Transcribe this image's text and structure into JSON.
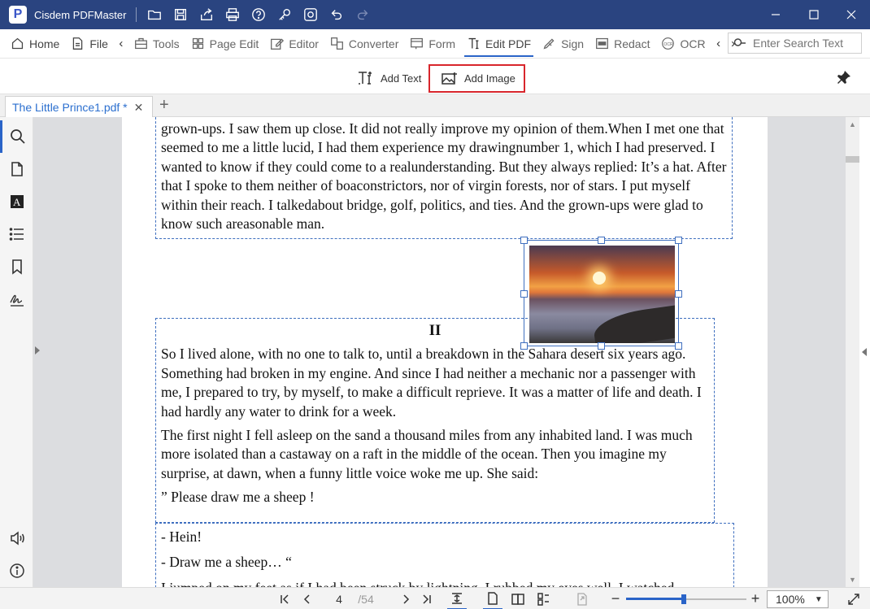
{
  "app": {
    "logo_letter": "P",
    "name": "Cisdem PDFMaster"
  },
  "menu": {
    "home": "Home",
    "file": "File",
    "tools": "Tools",
    "page_edit": "Page Edit",
    "editor": "Editor",
    "converter": "Converter",
    "form": "Form",
    "edit_pdf": "Edit PDF",
    "sign": "Sign",
    "redact": "Redact",
    "ocr": "OCR",
    "search_placeholder": "Enter Search Text"
  },
  "subtoolbar": {
    "add_text": "Add Text",
    "add_image": "Add Image"
  },
  "tab": {
    "title": "The Little Prince1.pdf *",
    "close": "✕",
    "add": "+"
  },
  "document": {
    "block1": "grown-ups. I saw them up close. It did not really improve my opinion of them.When I met one that seemed to me a little lucid, I had them experience my drawingnumber 1, which I had preserved. I wanted to know if they could come to a realunderstanding. But they always replied: It’s a hat. After that I spoke to them neither of boaconstrictors, nor of virgin forests, nor of stars. I put myself within their reach. I talkedabout bridge, golf, politics, and ties. And the grown-ups were glad to know such areasonable man.",
    "heading": "II",
    "para1": "So I lived alone, with no one to talk to, until a breakdown in the Sahara desert six years ago. Something had broken in my engine. And since I had neither a mechanic nor a passenger with me, I prepared to try, by myself, to make a difficult reprieve. It was a matter of life and death. I had hardly any water to drink for a week.",
    "para2": "The first night I fell asleep on the sand a thousand miles from any inhabited land. I was much more isolated than a castaway on a raft in the middle of the ocean. Then you imagine my surprise, at dawn, when a funny little voice woke me up. She said:",
    "para3": "” Please draw me a sheep !",
    "line1": "- Hein!",
    "line2": "- Draw me a sheep… “",
    "line3": "I jumped on my feet as if I had been struck by lightning. I rubbed my eyes well. I watched"
  },
  "status": {
    "current_page": "4",
    "total_pages": "/54",
    "zoom": "100%"
  },
  "colors": {
    "titlebar": "#2a4480",
    "accent": "#2a64c8",
    "highlight": "#d8262c",
    "selection": "#3f6fbf"
  }
}
